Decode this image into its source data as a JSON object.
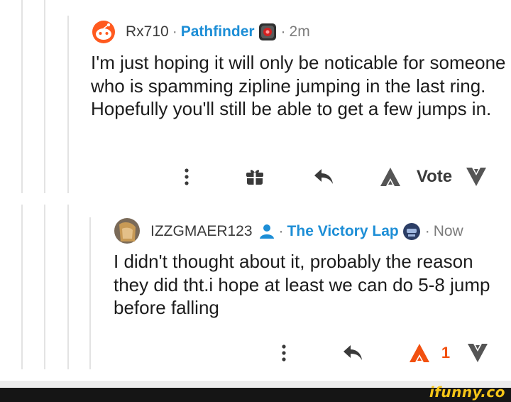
{
  "comments": [
    {
      "username": "Rx710",
      "separator": "·",
      "flair": "Pathfinder",
      "time_sep": "·",
      "time": "2m",
      "avatar_icon": "reddit-snoo-icon",
      "flair_icon": "pathfinder-robot-icon",
      "body": "I'm just hoping it will only be noticable for someone who is spamming zipline jumping in the last ring. Hopefully you'll still be able to get a few jumps in.",
      "actions": {
        "more_icon": "more-vertical-icon",
        "award_icon": "gift-icon",
        "reply_icon": "reply-icon",
        "upvote_icon": "apex-upvote-icon",
        "vote_label": "Vote",
        "downvote_icon": "apex-downvote-icon"
      }
    },
    {
      "username": "IZZGMAER123",
      "separator": "·",
      "flair": "The Victory Lap",
      "time_sep": "·",
      "time": "Now",
      "avatar_icon": "user-avatar-icon",
      "badge_icon": "user-badge-icon",
      "flair_icon": "victory-lap-icon",
      "body": "I didn't thought about it, probably the reason they did tht.i hope at least we can do 5-8 jump before falling",
      "actions": {
        "more_icon": "more-vertical-icon",
        "reply_icon": "reply-icon",
        "upvote_icon": "apex-upvote-icon",
        "vote_count": "1",
        "downvote_icon": "apex-downvote-icon"
      }
    }
  ],
  "colors": {
    "flair": "#1d8ed6",
    "upvoted": "#f2500f",
    "vote_gray": "#3a3a3a",
    "thread_line": "#e3e3e3"
  },
  "watermark": "ifunny.co"
}
